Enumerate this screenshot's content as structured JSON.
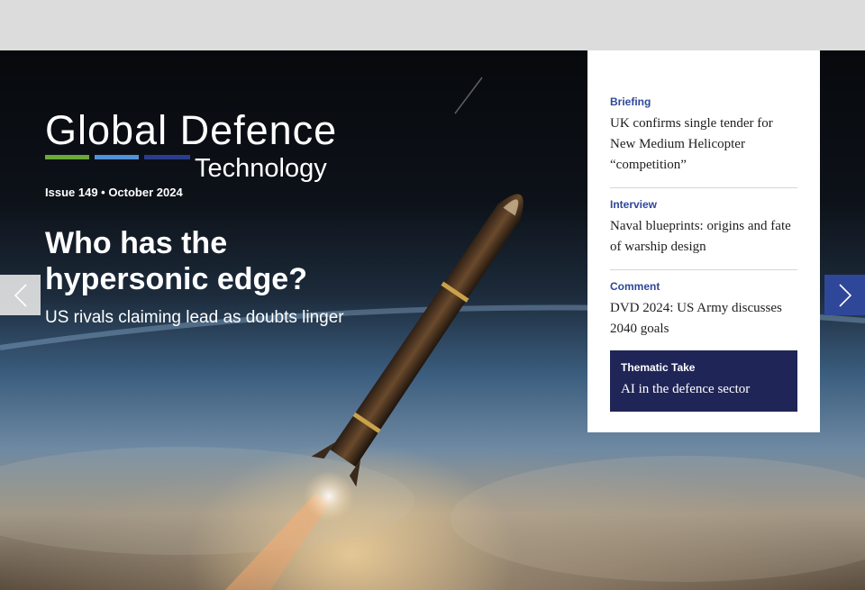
{
  "brand": {
    "line1": "Global Defence",
    "line2": "Technology",
    "bar_colors": [
      "#6aa83a",
      "#4f93d6",
      "#2a3d8c"
    ]
  },
  "issue": "Issue 149 • October 2024",
  "headline": "Who has the hypersonic edge?",
  "subhead": "US rivals claiming lead as doubts linger",
  "carousel": {
    "prev_icon": "chevron-left-icon",
    "next_icon": "chevron-right-icon"
  },
  "panel": {
    "items": [
      {
        "category": "Briefing",
        "title": "UK confirms single tender for New Medium Helicopter “competition”"
      },
      {
        "category": "Interview",
        "title": "Naval blueprints: origins and fate of warship design"
      },
      {
        "category": "Comment",
        "title": "DVD 2024: US Army discusses 2040 goals"
      }
    ],
    "thematic": {
      "category": "Thematic Take",
      "title": "AI in the defence sector"
    }
  },
  "colors": {
    "accent": "#2f4799",
    "thematic_bg": "#1f2557"
  }
}
